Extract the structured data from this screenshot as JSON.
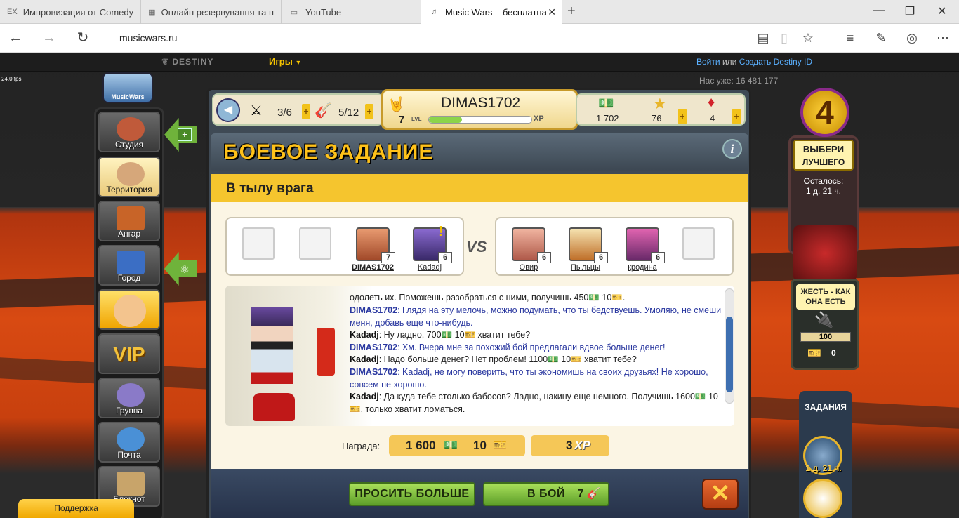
{
  "browser": {
    "tabs": [
      {
        "label": "Импровизация от Comedy",
        "icon": "EX"
      },
      {
        "label": "Онлайн резервування та п",
        "icon": "hotel-icon"
      },
      {
        "label": "YouTube",
        "icon": "page-icon"
      },
      {
        "label": "Music Wars – бесплатна",
        "icon": "music-wars-icon"
      }
    ],
    "new_tab": "+",
    "url": "musicwars.ru",
    "win_min": "—",
    "win_max": "❐",
    "win_close": "✕"
  },
  "site": {
    "brand": "DESTINY",
    "games": "Игры",
    "login": "Войти",
    "or": "или",
    "create": "Создать Destiny ID",
    "count_label": "Нас уже:",
    "count": "16 481 177",
    "fps": "24.0 fps"
  },
  "sidebar": {
    "logo": "MusicWars",
    "items": [
      "Студия",
      "Территория",
      "Ангар",
      "Город",
      "",
      "VIP",
      "Группа",
      "Почта",
      "Блокнот"
    ]
  },
  "stats": {
    "energy": "3/6",
    "attack": "5/12",
    "name": "DIMAS1702",
    "level": "7",
    "lvl_label": "LVL",
    "xp_label": "XP",
    "money": "1 702",
    "stars": "76",
    "gems": "4"
  },
  "mission": {
    "title": "БОЕВОЕ ЗАДАНИЕ",
    "subtitle": "В тылу врага",
    "info": "i",
    "vs": "VS",
    "left_team": [
      {
        "name": "DIMAS1702",
        "level": "7"
      },
      {
        "name": "Kadadj",
        "level": "6"
      }
    ],
    "right_team": [
      {
        "name": "Овир",
        "level": "6"
      },
      {
        "name": "Пыльцы",
        "level": "6"
      },
      {
        "name": "кродина",
        "level": "6"
      }
    ],
    "dialog": [
      {
        "speaker": "",
        "text": "одолеть их. Поможешь разобраться с ними, получишь 450💵 10🎫.",
        "blue": false
      },
      {
        "speaker": "DIMAS1702",
        "text": ": Глядя на эту мелочь, можно подумать, что ты бедствуешь. Умоляю, не смеши меня, добавь еще что-нибудь.",
        "blue": true
      },
      {
        "speaker": "Kadadj",
        "text": ": Ну ладно, 700💵 10🎫 хватит тебе?",
        "blue": false
      },
      {
        "speaker": "DIMAS1702",
        "text": ": Хм. Вчера мне за похожий бой предлагали вдвое больше денег!",
        "blue": true
      },
      {
        "speaker": "Kadadj",
        "text": ": Надо больше денег? Нет проблем! 1100💵 10🎫 хватит тебе?",
        "blue": false
      },
      {
        "speaker": "DIMAS1702",
        "text": ": Kadadj, не могу поверить, что ты экономишь на своих друзьях! Не хорошо, совсем не хорошо.",
        "blue": true
      },
      {
        "speaker": "Kadadj",
        "text": ": Да куда тебе столько бабосов? Ладно, накину еще немного. Получишь 1600💵 10🎫, только хватит ломаться.",
        "blue": false
      }
    ],
    "reward_label": "Награда:",
    "reward_money": "1 600",
    "reward_tickets": "10",
    "reward_xp": "3",
    "reward_xp_label": "XP",
    "ask_more": "ПРОСИТЬ БОЛЬШЕ",
    "fight": "В БОЙ",
    "fight_cost": "7"
  },
  "right_panel": {
    "badge_num": "4",
    "choose1": "ВЫБЕРИ",
    "choose2": "ЛУЧШЕГО",
    "left_label": "Осталось:",
    "left_time": "1 д. 21 ч.",
    "harsh1": "ЖЕСТЬ - КАК",
    "harsh2": "ОНА ЕСТЬ",
    "harsh_val1": "100",
    "harsh_val2": "0",
    "tasks": "ЗАДАНИЯ",
    "task_time": "1 д. 21 ч."
  },
  "support": "Поддержка",
  "colors": {
    "accent": "#f5c52e",
    "green": "#6fb33b",
    "panel": "#3f4a55"
  }
}
